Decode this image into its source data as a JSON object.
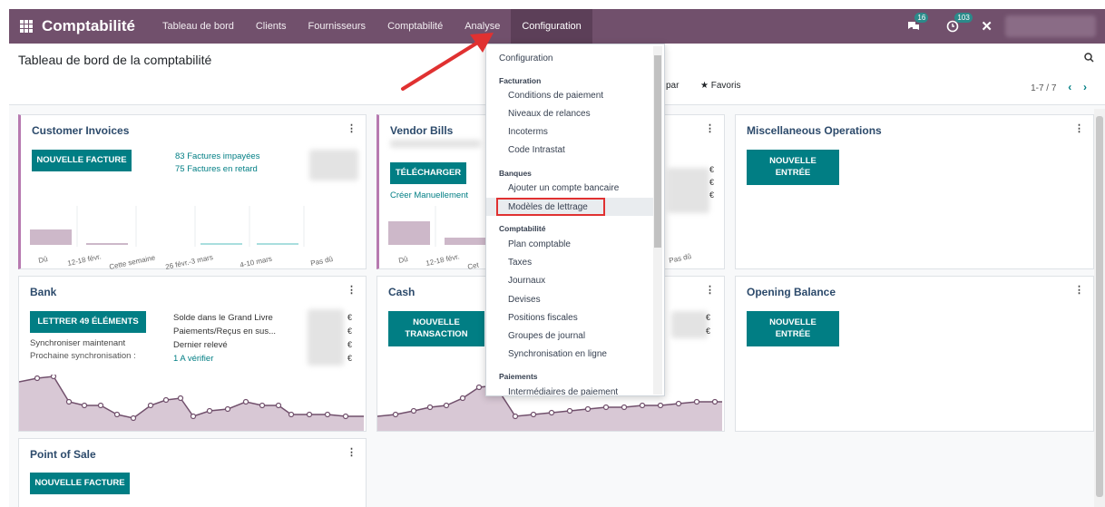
{
  "topbar": {
    "app_name": "Comptabilité",
    "menu": [
      "Tableau de bord",
      "Clients",
      "Fournisseurs",
      "Comptabilité",
      "Analyse",
      "Configuration"
    ],
    "messages_count": "16",
    "activities_count": "103"
  },
  "control": {
    "breadcrumb": "Tableau de bord de la comptabilité",
    "group_by_partial": "par",
    "favorites": "Favoris",
    "pager": "1-7 / 7"
  },
  "dropdown": {
    "title": "Configuration",
    "sections": [
      {
        "heading": "Facturation",
        "items": [
          "Conditions de paiement",
          "Niveaux de relances",
          "Incoterms",
          "Code Intrastat"
        ]
      },
      {
        "heading": "Banques",
        "items": [
          "Ajouter un compte bancaire",
          "Modèles de lettrage"
        ]
      },
      {
        "heading": "Comptabilité",
        "items": [
          "Plan comptable",
          "Taxes",
          "Journaux",
          "Devises",
          "Positions fiscales",
          "Groupes de journal",
          "Synchronisation en ligne"
        ]
      },
      {
        "heading": "Paiements",
        "items": [
          "Intermédiaires de paiement"
        ]
      }
    ],
    "highlighted": "Modèles de lettrage"
  },
  "cards": {
    "customer_invoices": {
      "title": "Customer Invoices",
      "button": "NOUVELLE FACTURE",
      "link1": "83 Factures impayées",
      "link2": "75 Factures en retard",
      "chart_labels": [
        "Dû",
        "12-18 févr.",
        "Cette semaine",
        "26 févr.-3 mars",
        "4-10 mars",
        "Pas dû"
      ]
    },
    "vendor_bills": {
      "title": "Vendor Bills",
      "button": "TÉLÉCHARGER",
      "link": "Créer Manuellement",
      "chart_labels": [
        "Dû",
        "12-18 févr.",
        "Cet",
        "Pas dû"
      ]
    },
    "misc": {
      "title": "Miscellaneous Operations",
      "button": "NOUVELLE ENTRÉE"
    },
    "bank": {
      "title": "Bank",
      "button": "LETTRER 49 ÉLÉMENTS",
      "sync": "Synchroniser maintenant",
      "next_sync": "Prochaine synchronisation :",
      "label1": "Solde dans le Grand Livre",
      "label2": "Paiements/Reçus en sus...",
      "label3": "Dernier relevé",
      "label4": "1 A vérifier",
      "currency": "€"
    },
    "cash": {
      "title": "Cash",
      "button": "NOUVELLE TRANSACTION"
    },
    "opening": {
      "title": "Opening Balance",
      "button": "NOUVELLE ENTRÉE"
    },
    "pos": {
      "title": "Point of Sale",
      "button": "NOUVELLE FACTURE"
    }
  }
}
